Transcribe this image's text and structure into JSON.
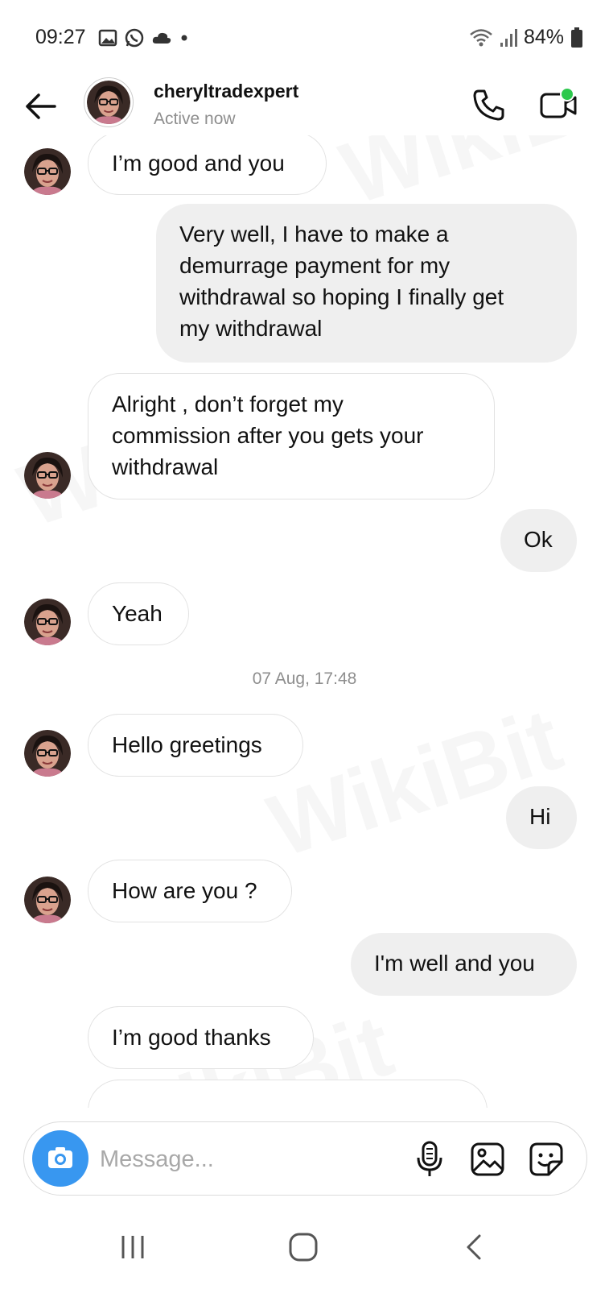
{
  "status_bar": {
    "time": "09:27",
    "battery": "84%",
    "icons_left": [
      "gallery-icon",
      "whatsapp-icon",
      "cloud-icon",
      "dot-icon"
    ],
    "icons_right": [
      "wifi-icon",
      "signal-icon",
      "battery-icon"
    ]
  },
  "header": {
    "username": "cheryltradexpert",
    "status": "Active now",
    "icons": [
      "back-arrow-icon",
      "phone-icon",
      "video-camera-icon"
    ],
    "online_dot_color": "#2dc84d"
  },
  "messages": [
    {
      "from": "them",
      "text": "I’m good and you",
      "avatar": true
    },
    {
      "from": "me",
      "text": "Very well, I have to make a\ndemurrage payment for my\nwithdrawal so hoping I finally get\nmy withdrawal"
    },
    {
      "from": "them",
      "text": "Alright , don’t forget my\ncommission after you gets your\nwithdrawal",
      "avatar": true
    },
    {
      "from": "me",
      "text": "Ok"
    },
    {
      "from": "them",
      "text": "Yeah",
      "avatar": true
    },
    {
      "timestamp": "07 Aug, 17:48"
    },
    {
      "from": "them",
      "text": "Hello greetings",
      "avatar": true
    },
    {
      "from": "me",
      "text": "Hi"
    },
    {
      "from": "them",
      "text": "How are you ?",
      "avatar": true
    },
    {
      "from": "me",
      "text": "I'm well and you"
    },
    {
      "from": "them",
      "text": "I’m good thanks",
      "avatar": false
    }
  ],
  "composer": {
    "placeholder": "Message...",
    "icons": [
      "camera-icon",
      "microphone-icon",
      "gallery-icon",
      "sticker-icon"
    ]
  },
  "navbar": {
    "icons": [
      "recent-apps-icon",
      "home-icon",
      "back-icon"
    ]
  },
  "watermark": "WikiBit",
  "colors": {
    "accent": "#3897f0",
    "outgoing_bubble": "#efefef",
    "incoming_border": "#e2e2e2",
    "secondary_text": "#8e8e8e"
  }
}
